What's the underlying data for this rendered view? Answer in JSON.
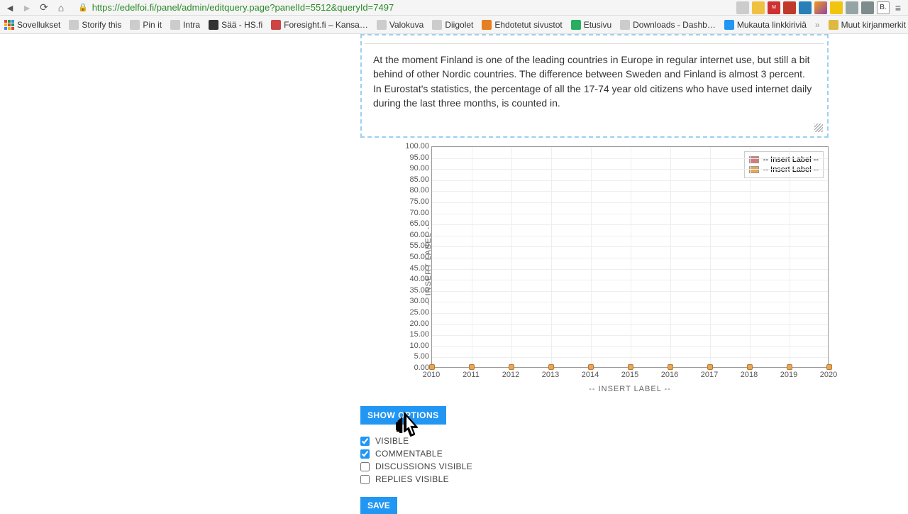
{
  "browser": {
    "url": "https://edelfoi.fi/panel/admin/editquery.page?panelId=5512&queryId=7497",
    "bookmarks": [
      "Sovellukset",
      "Storify this",
      "Pin it",
      "Intra",
      "Sää - HS.fi",
      "Foresight.fi – Kansa…",
      "Valokuva",
      "Diigolet",
      "Ehdotetut sivustot",
      "Etusivu",
      "Downloads - Dashb…",
      "Mukauta linkkiriviä",
      "Muut kirjanmerkit"
    ]
  },
  "editor": {
    "text": "At the moment Finland is one of the leading countries in Europe in regular internet use, but still a bit behind of other Nordic countries. The difference between Sweden and Finland is almost 3 percent. In Eurostat's statistics, the percentage of all the 17-74 year old citizens who have used internet daily during the last three months, is counted in."
  },
  "chart_data": {
    "type": "line",
    "x": [
      2010,
      2011,
      2012,
      2013,
      2014,
      2015,
      2016,
      2017,
      2018,
      2019,
      2020
    ],
    "series": [
      {
        "name": "-- Insert Label --",
        "color": "#d77a7a",
        "values": [
          null,
          null,
          null,
          null,
          null,
          null,
          null,
          null,
          null,
          null,
          null
        ]
      },
      {
        "name": "-- Insert Label --",
        "color": "#e8a657",
        "values": [
          0,
          0,
          0,
          0,
          0,
          0,
          0,
          0,
          0,
          0,
          0
        ]
      }
    ],
    "ylabel": "-- INSERT LABEL --",
    "xlabel": "-- INSERT LABEL --",
    "ylim": [
      0,
      100
    ],
    "ystep": 5,
    "y_ticks": [
      "100.00",
      "95.00",
      "90.00",
      "85.00",
      "80.00",
      "75.00",
      "70.00",
      "65.00",
      "60.00",
      "55.00",
      "50.00",
      "45.00",
      "40.00",
      "35.00",
      "30.00",
      "25.00",
      "20.00",
      "15.00",
      "10.00",
      "5.00",
      "0.00"
    ]
  },
  "options": {
    "button": "SHOW OPTIONS",
    "items": [
      {
        "label": "VISIBLE",
        "checked": true
      },
      {
        "label": "COMMENTABLE",
        "checked": true
      },
      {
        "label": "DISCUSSIONS VISIBLE",
        "checked": false
      },
      {
        "label": "REPLIES VISIBLE",
        "checked": false
      }
    ],
    "save": "SAVE"
  }
}
